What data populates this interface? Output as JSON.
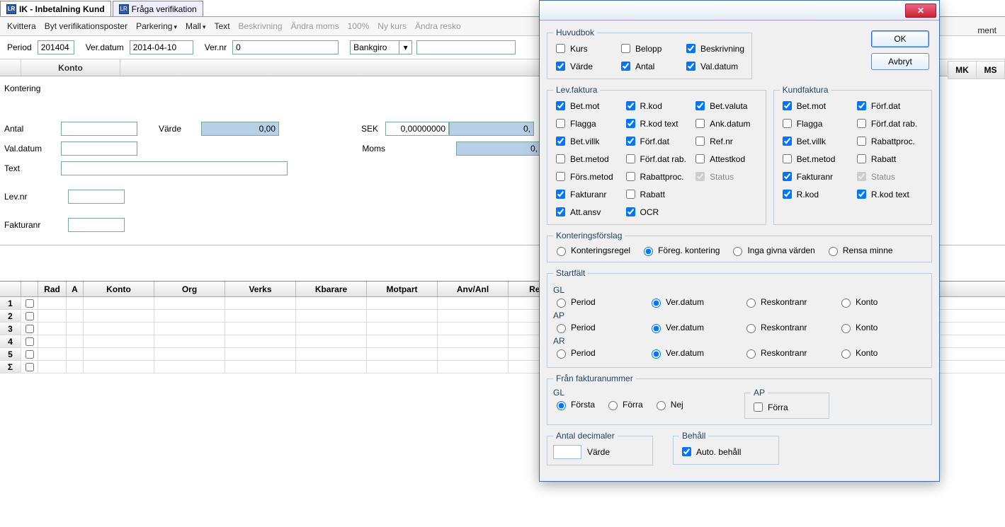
{
  "tabs": [
    {
      "label": "IK - Inbetalning Kund",
      "active": true
    },
    {
      "label": "Fråga verifikation",
      "active": false
    }
  ],
  "toolbar": {
    "items": [
      {
        "label": "Kvittera",
        "disabled": false
      },
      {
        "label": "Byt verifikationsposter",
        "disabled": false
      },
      {
        "label": "Parkering",
        "disabled": false,
        "dd": true
      },
      {
        "label": "Mall",
        "disabled": false,
        "dd": true
      },
      {
        "label": "Text",
        "disabled": false
      },
      {
        "label": "Beskrivning",
        "disabled": true
      },
      {
        "label": "Ändra moms",
        "disabled": true
      },
      {
        "label": "100%",
        "disabled": true
      },
      {
        "label": "Ny kurs",
        "disabled": true
      },
      {
        "label": "Ändra resko",
        "disabled": true
      }
    ],
    "right_end": "ment"
  },
  "fields": {
    "period_label": "Period",
    "period": "201404",
    "verdatum_label": "Ver.datum",
    "verdatum": "2014-04-10",
    "vernr_label": "Ver.nr",
    "vernr": "0",
    "paytype": "Bankgiro",
    "extra": ""
  },
  "grid_header": {
    "konto": "Konto",
    "mk": "MK",
    "ms": "MS"
  },
  "kontering": {
    "title": "Kontering",
    "antal_label": "Antal",
    "antal": "",
    "varde_label": "Värde",
    "varde": "0,00",
    "sek_label": "SEK",
    "sek": "0,00000000",
    "sek2": "0,",
    "valdatum_label": "Val.datum",
    "valdatum": "",
    "moms_label": "Moms",
    "moms": "0,",
    "text_label": "Text",
    "text": "",
    "levnr_label": "Lev.nr",
    "levnr": "",
    "fakturanr_label": "Fakturanr",
    "fakturanr": ""
  },
  "datagrid": {
    "cols": [
      "Rad",
      "A",
      "Konto",
      "Org",
      "Verks",
      "Kbarare",
      "Motpart",
      "Anv/Anl",
      "Resurs"
    ],
    "rows": [
      "1",
      "2",
      "3",
      "4",
      "5",
      "Σ"
    ]
  },
  "dialog": {
    "ok": "OK",
    "cancel": "Avbryt",
    "huvudbok": {
      "legend": "Huvudbok",
      "items": [
        {
          "label": "Kurs",
          "checked": false
        },
        {
          "label": "Belopp",
          "checked": false
        },
        {
          "label": "Beskrivning",
          "checked": true
        },
        {
          "label": "Värde",
          "checked": true
        },
        {
          "label": "Antal",
          "checked": true
        },
        {
          "label": "Val.datum",
          "checked": true
        }
      ]
    },
    "levfaktura": {
      "legend": "Lev.faktura",
      "items": [
        {
          "label": "Bet.mot",
          "checked": true
        },
        {
          "label": "R.kod",
          "checked": true
        },
        {
          "label": "Bet.valuta",
          "checked": true
        },
        {
          "label": "Flagga",
          "checked": false
        },
        {
          "label": "R.kod text",
          "checked": true
        },
        {
          "label": "Ank.datum",
          "checked": false
        },
        {
          "label": "Bet.villk",
          "checked": true
        },
        {
          "label": "Förf.dat",
          "checked": true
        },
        {
          "label": "Ref.nr",
          "checked": false
        },
        {
          "label": "Bet.metod",
          "checked": false
        },
        {
          "label": "Förf.dat rab.",
          "checked": false
        },
        {
          "label": "Attestkod",
          "checked": false
        },
        {
          "label": "Förs.metod",
          "checked": false
        },
        {
          "label": "Rabattproc.",
          "checked": false
        },
        {
          "label": "Status",
          "checked": true,
          "disabled": true
        },
        {
          "label": "Fakturanr",
          "checked": true
        },
        {
          "label": "Rabatt",
          "checked": false
        },
        {
          "label": "",
          "checked": false,
          "spacer": true
        },
        {
          "label": "Att.ansv",
          "checked": true
        },
        {
          "label": "OCR",
          "checked": true
        }
      ]
    },
    "kundfaktura": {
      "legend": "Kundfaktura",
      "items": [
        {
          "label": "Bet.mot",
          "checked": true
        },
        {
          "label": "Förf.dat",
          "checked": true
        },
        {
          "label": "Flagga",
          "checked": false
        },
        {
          "label": "Förf.dat rab.",
          "checked": false
        },
        {
          "label": "Bet.villk",
          "checked": true
        },
        {
          "label": "Rabattproc.",
          "checked": false
        },
        {
          "label": "Bet.metod",
          "checked": false
        },
        {
          "label": "Rabatt",
          "checked": false
        },
        {
          "label": "Fakturanr",
          "checked": true
        },
        {
          "label": "Status",
          "checked": true,
          "disabled": true
        },
        {
          "label": "R.kod",
          "checked": true
        },
        {
          "label": "R.kod text",
          "checked": true
        }
      ]
    },
    "konteringsforslag": {
      "legend": "Konteringsförslag",
      "options": [
        "Konteringsregel",
        "Föreg. kontering",
        "Inga givna värden",
        "Rensa minne"
      ],
      "selected": 1
    },
    "startfalt": {
      "legend": "Startfält",
      "groups": [
        {
          "name": "GL",
          "options": [
            "Period",
            "Ver.datum",
            "Reskontranr",
            "Konto"
          ],
          "selected": 1
        },
        {
          "name": "AP",
          "options": [
            "Period",
            "Ver.datum",
            "Reskontranr",
            "Konto"
          ],
          "selected": 1
        },
        {
          "name": "AR",
          "options": [
            "Period",
            "Ver.datum",
            "Reskontranr",
            "Konto"
          ],
          "selected": 1
        }
      ]
    },
    "franfakturanummer": {
      "legend": "Från fakturanummer",
      "gl_label": "GL",
      "gl_options": [
        "Första",
        "Förra",
        "Nej"
      ],
      "gl_selected": 0,
      "ap_label": "AP",
      "ap_forr_label": "Förra",
      "ap_forr_checked": false
    },
    "antaldec": {
      "label": "Antal decimaler",
      "value": "",
      "unit": "Värde"
    },
    "behall": {
      "label": "Behåll",
      "autolabel": "Auto. behåll",
      "checked": true
    }
  }
}
